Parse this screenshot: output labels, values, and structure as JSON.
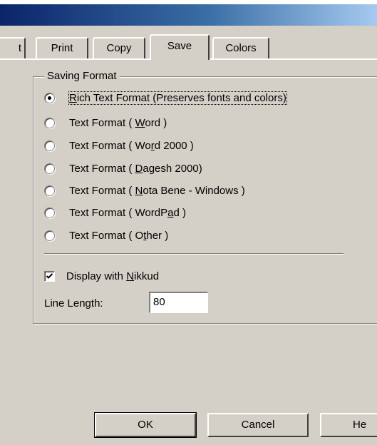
{
  "tabs": [
    {
      "label": "t",
      "active": false
    },
    {
      "label": "Print",
      "active": false
    },
    {
      "label": "Copy",
      "active": false
    },
    {
      "label": "Save",
      "active": true
    },
    {
      "label": "Colors",
      "active": false
    }
  ],
  "saving_format": {
    "label": "Saving Format",
    "options": [
      {
        "pre": "",
        "key": "R",
        "post": "ich Text Format (Preserves fonts and colors)",
        "checked": true
      },
      {
        "pre": "Text Format ( ",
        "key": "W",
        "post": "ord )",
        "checked": false
      },
      {
        "pre": "Text Format ( Wo",
        "key": "r",
        "post": "d 2000 )",
        "checked": false
      },
      {
        "pre": "Text Format ( ",
        "key": "D",
        "post": "agesh 2000)",
        "checked": false
      },
      {
        "pre": "Text Format ( ",
        "key": "N",
        "post": "ota Bene - Windows )",
        "checked": false
      },
      {
        "pre": "Text Format ( WordP",
        "key": "a",
        "post": "d )",
        "checked": false
      },
      {
        "pre": "Text Format ( O",
        "key": "t",
        "post": "her )",
        "checked": false
      }
    ]
  },
  "display_nikkud": {
    "pre": "Display with ",
    "key": "N",
    "post": "ikkud",
    "checked": true
  },
  "line_length": {
    "label": "Line Length:",
    "value": "80"
  },
  "buttons": {
    "ok": "OK",
    "cancel": "Cancel",
    "help": "He"
  }
}
